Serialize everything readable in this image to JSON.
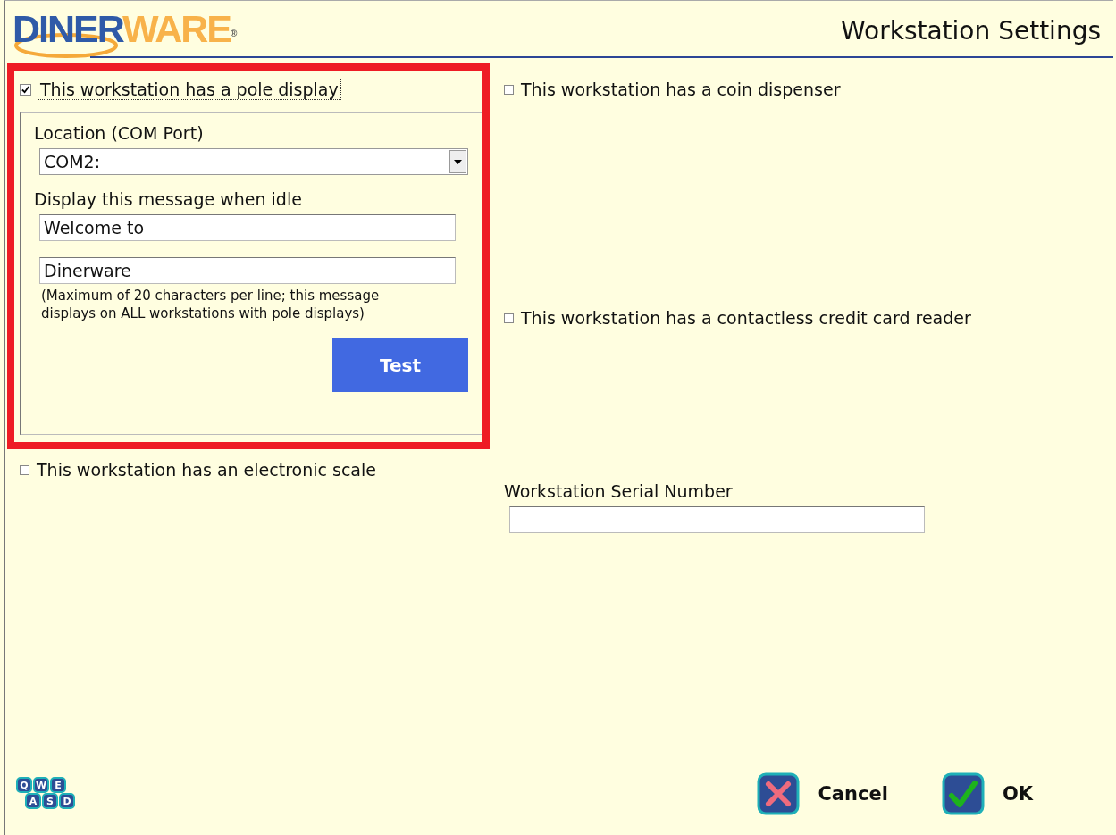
{
  "logo": {
    "part_1": "DINER",
    "part_2": "WARE",
    "mark": "®"
  },
  "title": "Workstation Settings",
  "pole_display": {
    "label": "This workstation has a pole display",
    "checked": true,
    "highlighted": true,
    "location_label": "Location (COM Port)",
    "location_value": "COM2:",
    "message_label": "Display this message when idle",
    "line_1": "Welcome to",
    "line_2": "Dinerware",
    "note": "(Maximum of 20 characters per line; this message displays on ALL workstations with pole displays)",
    "test_button": "Test"
  },
  "scale": {
    "label": "This workstation has an electronic scale",
    "checked": false
  },
  "coin_dispenser": {
    "label": "This workstation has a coin dispenser",
    "checked": false
  },
  "contactless": {
    "label": "This workstation has a contactless credit card reader",
    "checked": false
  },
  "serial": {
    "label": "Workstation Serial Number"
  },
  "keyboard_keys": [
    [
      "Q",
      "W",
      "E"
    ],
    [
      "A",
      "S",
      "D"
    ]
  ],
  "buttons": [
    {
      "kind": "cancel",
      "label": "Cancel"
    },
    {
      "kind": "ok",
      "label": "OK"
    }
  ]
}
